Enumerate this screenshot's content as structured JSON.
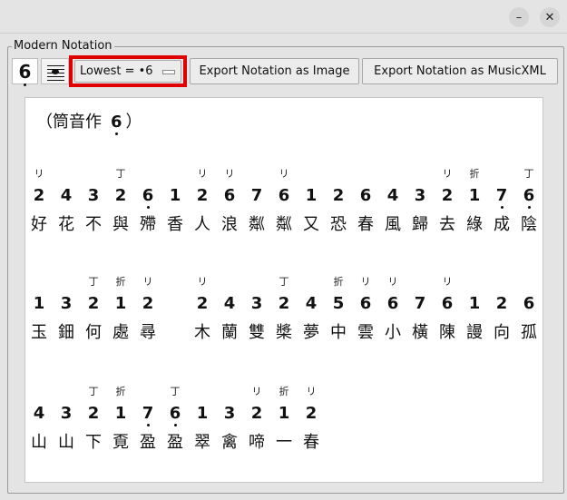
{
  "window": {
    "minimize_glyph": "–",
    "close_glyph": "✕"
  },
  "group_title": "Modern Notation",
  "toolbar": {
    "symbol_label": "6",
    "lowest_select": "Lowest = •6",
    "export_image_label": "Export Notation as Image",
    "export_xml_label": "Export Notation as MusicXML"
  },
  "notation": {
    "heading_prefix": "（筒音作",
    "heading_note": "6",
    "heading_suffix": "）",
    "rows": [
      {
        "marks": [
          "リ",
          "",
          "",
          "丁",
          "",
          "",
          "リ",
          "リ",
          "",
          "リ",
          "",
          "",
          "",
          "",
          "",
          "リ",
          "折",
          "",
          "丁"
        ],
        "nums": [
          "2",
          "4",
          "3",
          "2",
          "6",
          "1",
          "2",
          "6",
          "7",
          "6",
          "1",
          "2",
          "6",
          "4",
          "3",
          "2",
          "1",
          "7",
          "6"
        ],
        "lowdot": [
          false,
          false,
          false,
          false,
          true,
          false,
          false,
          false,
          false,
          false,
          false,
          false,
          false,
          false,
          false,
          false,
          false,
          true,
          true
        ],
        "chars": [
          "好",
          "花",
          "不",
          "與",
          "殢",
          "香",
          "人",
          "浪",
          "粼",
          "粼",
          "又",
          "恐",
          "春",
          "風",
          "歸",
          "去",
          "綠",
          "成",
          "陰"
        ]
      },
      {
        "marks": [
          "",
          "",
          "丁",
          "折",
          "リ",
          "",
          "リ",
          "",
          "",
          "丁",
          "",
          "折",
          "リ",
          "リ",
          "",
          "リ",
          "",
          "",
          ""
        ],
        "nums": [
          "1",
          "3",
          "2",
          "1",
          "2",
          "",
          "2",
          "4",
          "3",
          "2",
          "4",
          "5",
          "6",
          "6",
          "7",
          "6",
          "1",
          "2",
          "6"
        ],
        "lowdot": [
          false,
          false,
          false,
          false,
          false,
          false,
          false,
          false,
          false,
          false,
          false,
          false,
          false,
          false,
          false,
          false,
          false,
          false,
          false
        ],
        "chars": [
          "玉",
          "鈿",
          "何",
          "處",
          "尋",
          "",
          "木",
          "蘭",
          "雙",
          "槳",
          "夢",
          "中",
          "雲",
          "小",
          "橫",
          "陳",
          "謾",
          "向",
          "孤"
        ]
      },
      {
        "marks": [
          "",
          "",
          "丁",
          "折",
          "",
          "丁",
          "",
          "",
          "リ",
          "折",
          "リ"
        ],
        "nums": [
          "4",
          "3",
          "2",
          "1",
          "7",
          "6",
          "1",
          "3",
          "2",
          "1",
          "2"
        ],
        "lowdot": [
          false,
          false,
          false,
          false,
          true,
          true,
          false,
          false,
          false,
          false,
          false
        ],
        "chars": [
          "山",
          "山",
          "下",
          "覔",
          "盈",
          "盈",
          "翠",
          "禽",
          "啼",
          "一",
          "春"
        ]
      }
    ]
  }
}
